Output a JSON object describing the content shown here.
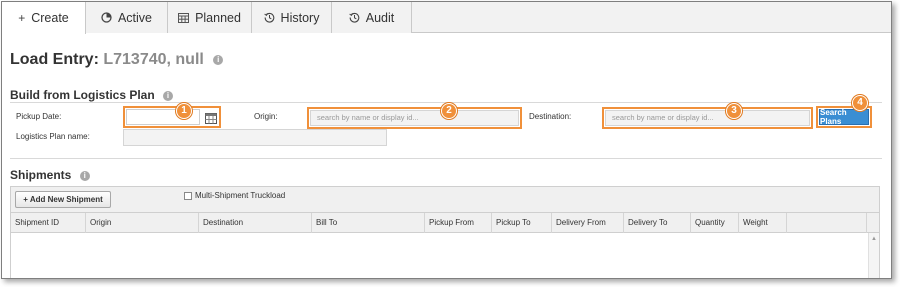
{
  "tabs": [
    {
      "label": "Create",
      "icon": "plus-icon"
    },
    {
      "label": "Active",
      "icon": "active-icon"
    },
    {
      "label": "Planned",
      "icon": "calendar-icon"
    },
    {
      "label": "History",
      "icon": "history-icon"
    },
    {
      "label": "Audit",
      "icon": "history-icon"
    }
  ],
  "page": {
    "title_prefix": "Load Entry:",
    "title_value": "L713740, null"
  },
  "build": {
    "title": "Build from Logistics Plan",
    "pickup_date_label": "Pickup Date:",
    "plan_name_label": "Logistics Plan name:",
    "origin_label": "Origin:",
    "origin_placeholder": "search by name or display id...",
    "destination_label": "Destination:",
    "destination_placeholder": "search by name or display id...",
    "search_button": "Search Plans",
    "pickup_date_value": "",
    "plan_name_value": ""
  },
  "callouts": [
    "1",
    "2",
    "3",
    "4"
  ],
  "shipments": {
    "title": "Shipments",
    "add_button": "+ Add New Shipment",
    "multi_checkbox_label": "Multi-Shipment Truckload",
    "columns": [
      "Shipment ID",
      "Origin",
      "Destination",
      "Bill To",
      "Pickup From",
      "Pickup To",
      "Delivery From",
      "Delivery To",
      "Quantity",
      "Weight"
    ]
  },
  "colors": {
    "accent": "#f0903a",
    "button_blue": "#3a8ed3"
  }
}
